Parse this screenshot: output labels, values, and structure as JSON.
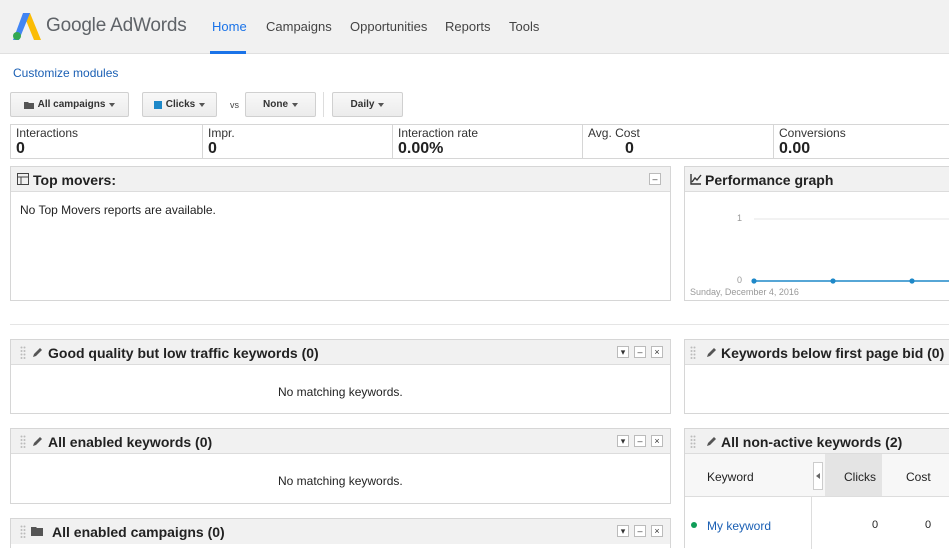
{
  "header": {
    "brand": "Google AdWords",
    "nav": [
      {
        "label": "Home",
        "active": true
      },
      {
        "label": "Campaigns"
      },
      {
        "label": "Opportunities"
      },
      {
        "label": "Reports"
      },
      {
        "label": "Tools"
      }
    ]
  },
  "customize_modules": "Customize modules",
  "controls": {
    "campaign_filter": "All campaigns",
    "metric1": "Clicks",
    "vs": "vs",
    "metric2": "None",
    "granularity": "Daily"
  },
  "metrics": [
    {
      "label": "Interactions",
      "value": "0"
    },
    {
      "label": "Impr.",
      "value": "0"
    },
    {
      "label": "Interaction rate",
      "value": "0.00%"
    },
    {
      "label": "Avg. Cost",
      "value": "0"
    },
    {
      "label": "Conversions",
      "value": "0.00"
    }
  ],
  "top_movers": {
    "title": "Top movers:",
    "message": "No Top Movers reports are available."
  },
  "performance_graph": {
    "title": "Performance graph",
    "y_tick_top": "1",
    "y_tick_bottom": "0",
    "x_label": "Sunday, December 4, 2016"
  },
  "chart_data": {
    "type": "line",
    "title": "Performance graph",
    "series": [
      {
        "name": "Clicks",
        "values": [
          0,
          0,
          0,
          0
        ]
      }
    ],
    "ylim": [
      0,
      1
    ],
    "yticks": [
      0,
      1
    ],
    "x_label": "Sunday, December 4, 2016"
  },
  "good_quality": {
    "title": "Good quality but low traffic keywords (0)",
    "message": "No matching keywords."
  },
  "below_first_page": {
    "title": "Keywords below first page bid (0)"
  },
  "all_enabled_keywords": {
    "title": "All enabled keywords (0)",
    "message": "No matching keywords."
  },
  "all_non_active": {
    "title": "All non-active keywords (2)",
    "columns": [
      "Keyword",
      "Clicks",
      "Cost"
    ],
    "rows": [
      {
        "keyword": "My keyword",
        "clicks": "0",
        "cost": "0"
      }
    ]
  },
  "all_enabled_campaigns": {
    "title": "All enabled campaigns (0)"
  },
  "colors": {
    "accent": "#1a73e8",
    "link": "#1a5fb4",
    "status_enabled": "#0f9d58",
    "metric_swatch": "#1e88c8"
  }
}
